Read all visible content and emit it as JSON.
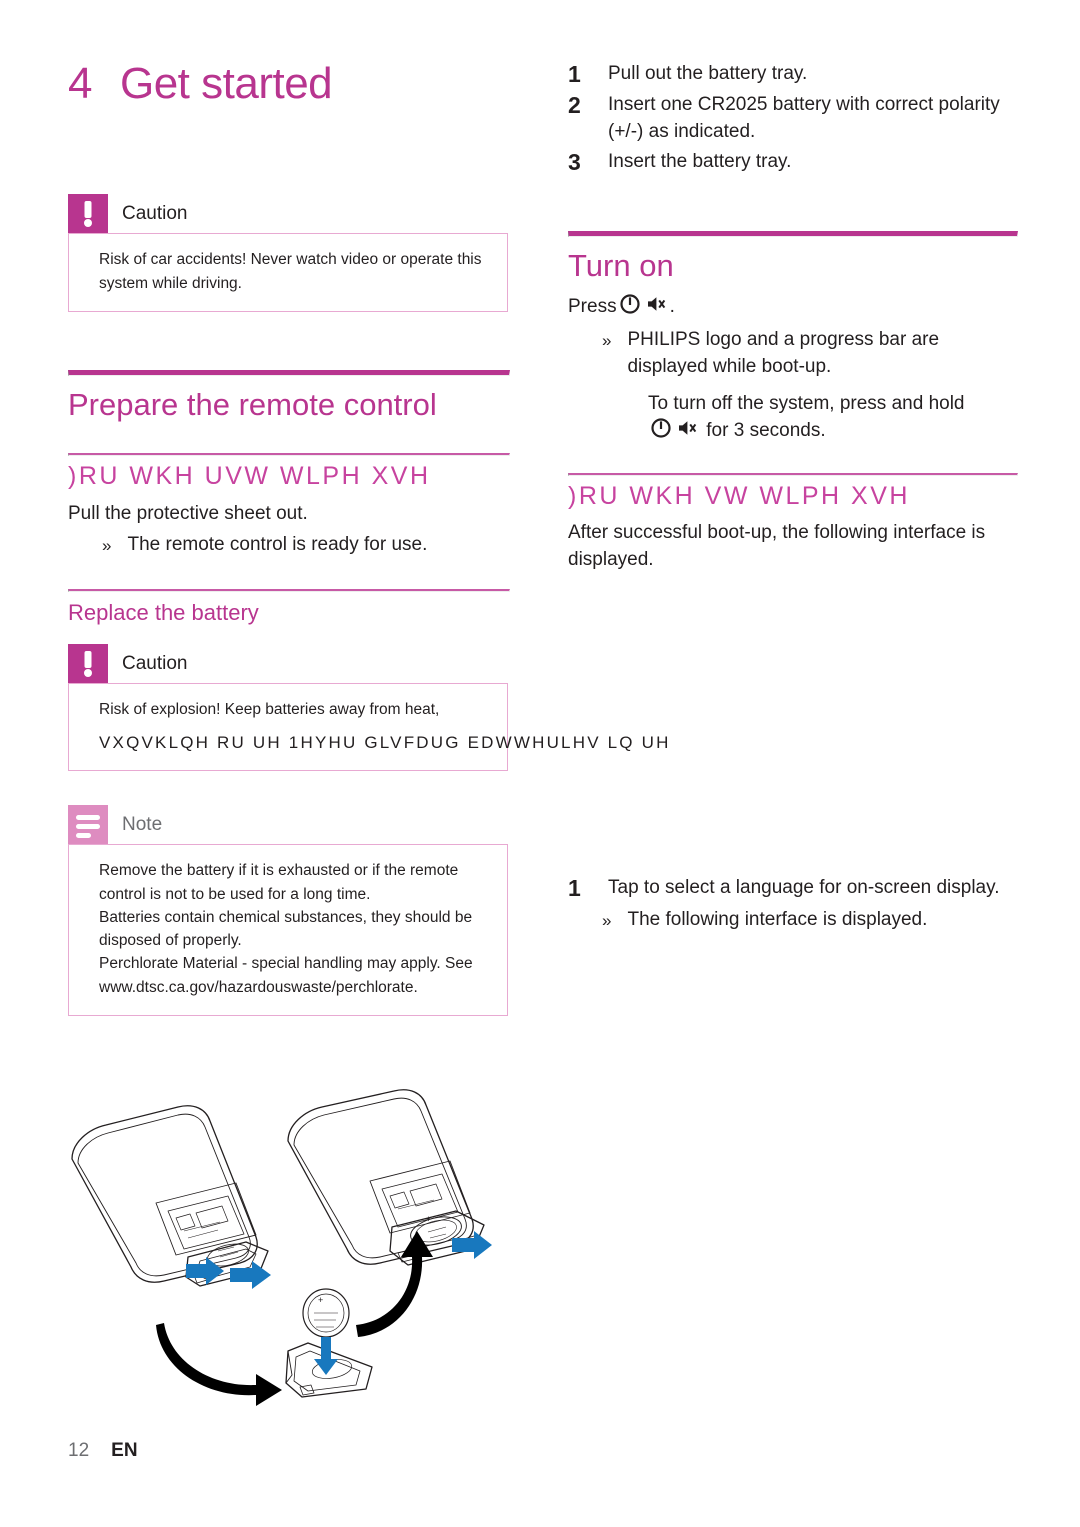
{
  "chapter": {
    "number": "4",
    "title": "Get started"
  },
  "left": {
    "caution_top": {
      "label": "Caution",
      "text": "Risk of car accidents! Never watch video or operate this system while driving."
    },
    "section_prepare": "Prepare the remote control",
    "garbled_first_time": ")RU WKH  UVW WLPH XVH",
    "first_time_text": "Pull the protective sheet out.",
    "first_time_bullet": "The remote control is ready for use.",
    "subsection_replace": "Replace the battery",
    "caution_battery": {
      "label": "Caution",
      "text": "Risk of explosion! Keep batteries away from heat,",
      "garbled_overflow": "VXQVKLQH RU  UH  1HYHU GLVFDUG EDWWHULHV LQ  UH"
    },
    "note": {
      "label": "Note",
      "lines": [
        "Remove the battery if it is exhausted or if the remote control is not to be used for a long time.",
        "Batteries contain chemical substances, they should be disposed of properly.",
        "Perchlorate Material - special handling may apply. See www.dtsc.ca.gov/hazardouswaste/perchlorate."
      ]
    }
  },
  "right": {
    "steps_battery": [
      {
        "num": "1",
        "text": "Pull out the battery tray."
      },
      {
        "num": "2",
        "text": "Insert one CR2025 battery with correct polarity (+/-) as indicated."
      },
      {
        "num": "3",
        "text": "Insert the battery tray."
      }
    ],
    "section_turn_on": "Turn on",
    "press_label": "Press",
    "press_suffix": ".",
    "boot_bullet": "PHILIPS logo and a progress bar are displayed while boot-up.",
    "turn_off_pre": "To turn off the system, press and hold",
    "turn_off_post": "for 3 seconds.",
    "garbled_first_time": ")RU WKH  VW WLPH XVH",
    "after_boot_text": "After successful boot-up, the following interface is displayed.",
    "steps_language": [
      {
        "num": "1",
        "text": "Tap to select a language for on-screen display."
      }
    ],
    "language_bullet": "The following interface is displayed."
  },
  "illustration": {
    "name": "remote-control-battery-replacement-diagram",
    "arrow_color": "#1878be"
  },
  "footer": {
    "page": "12",
    "language": "EN"
  },
  "colors": {
    "magenta": "#b8358f",
    "magenta_light": "#de8cc0",
    "border_pink": "#e8a9d2",
    "blue": "#1878be"
  }
}
